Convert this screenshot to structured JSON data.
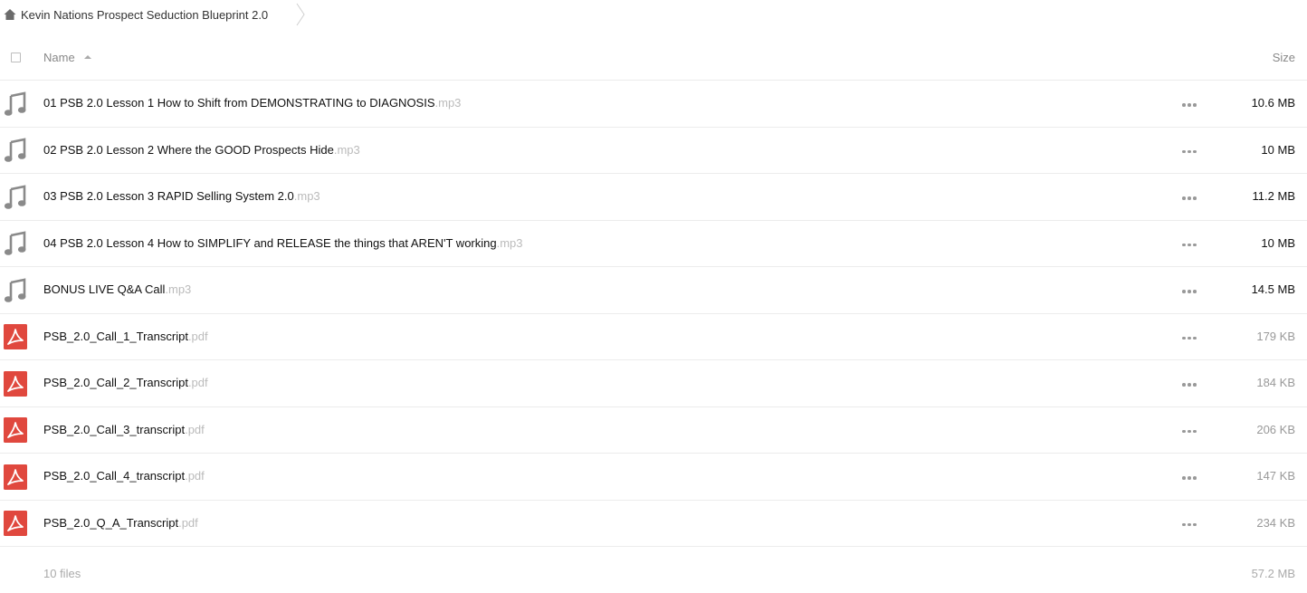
{
  "breadcrumb": {
    "home_icon": "home-icon",
    "title": "Kevin Nations Prospect Seduction Blueprint 2.0"
  },
  "header": {
    "name_label": "Name",
    "size_label": "Size",
    "sort_direction": "ascending"
  },
  "colors": {
    "audio_icon": "#8a8a8a",
    "pdf_icon": "#e0483e",
    "extension": "#bbbbbb",
    "divider": "#ececec"
  },
  "files": [
    {
      "name": "01 PSB 2.0 Lesson 1 How to Shift from DEMONSTRATING to DIAGNOSIS",
      "ext": ".mp3",
      "size": "10.6 MB",
      "type": "audio",
      "icon": "music-note-icon"
    },
    {
      "name": "02 PSB 2.0 Lesson 2 Where the GOOD Prospects Hide",
      "ext": ".mp3",
      "size": "10 MB",
      "type": "audio",
      "icon": "music-note-icon"
    },
    {
      "name": "03 PSB 2.0 Lesson 3 RAPID Selling System 2.0",
      "ext": ".mp3",
      "size": "11.2 MB",
      "type": "audio",
      "icon": "music-note-icon"
    },
    {
      "name": "04 PSB 2.0 Lesson 4 How to SIMPLIFY and RELEASE the things that AREN'T working",
      "ext": ".mp3",
      "size": "10 MB",
      "type": "audio",
      "icon": "music-note-icon"
    },
    {
      "name": "BONUS LIVE Q&A Call",
      "ext": ".mp3",
      "size": "14.5 MB",
      "type": "audio",
      "icon": "music-note-icon"
    },
    {
      "name": "PSB_2.0_Call_1_Transcript",
      "ext": ".pdf",
      "size": "179 KB",
      "type": "pdf",
      "icon": "pdf-icon"
    },
    {
      "name": "PSB_2.0_Call_2_Transcript",
      "ext": ".pdf",
      "size": "184 KB",
      "type": "pdf",
      "icon": "pdf-icon"
    },
    {
      "name": "PSB_2.0_Call_3_transcript",
      "ext": ".pdf",
      "size": "206 KB",
      "type": "pdf",
      "icon": "pdf-icon"
    },
    {
      "name": "PSB_2.0_Call_4_transcript",
      "ext": ".pdf",
      "size": "147 KB",
      "type": "pdf",
      "icon": "pdf-icon"
    },
    {
      "name": "PSB_2.0_Q_A_Transcript",
      "ext": ".pdf",
      "size": "234 KB",
      "type": "pdf",
      "icon": "pdf-icon"
    }
  ],
  "footer": {
    "count": "10 files",
    "total": "57.2 MB"
  }
}
